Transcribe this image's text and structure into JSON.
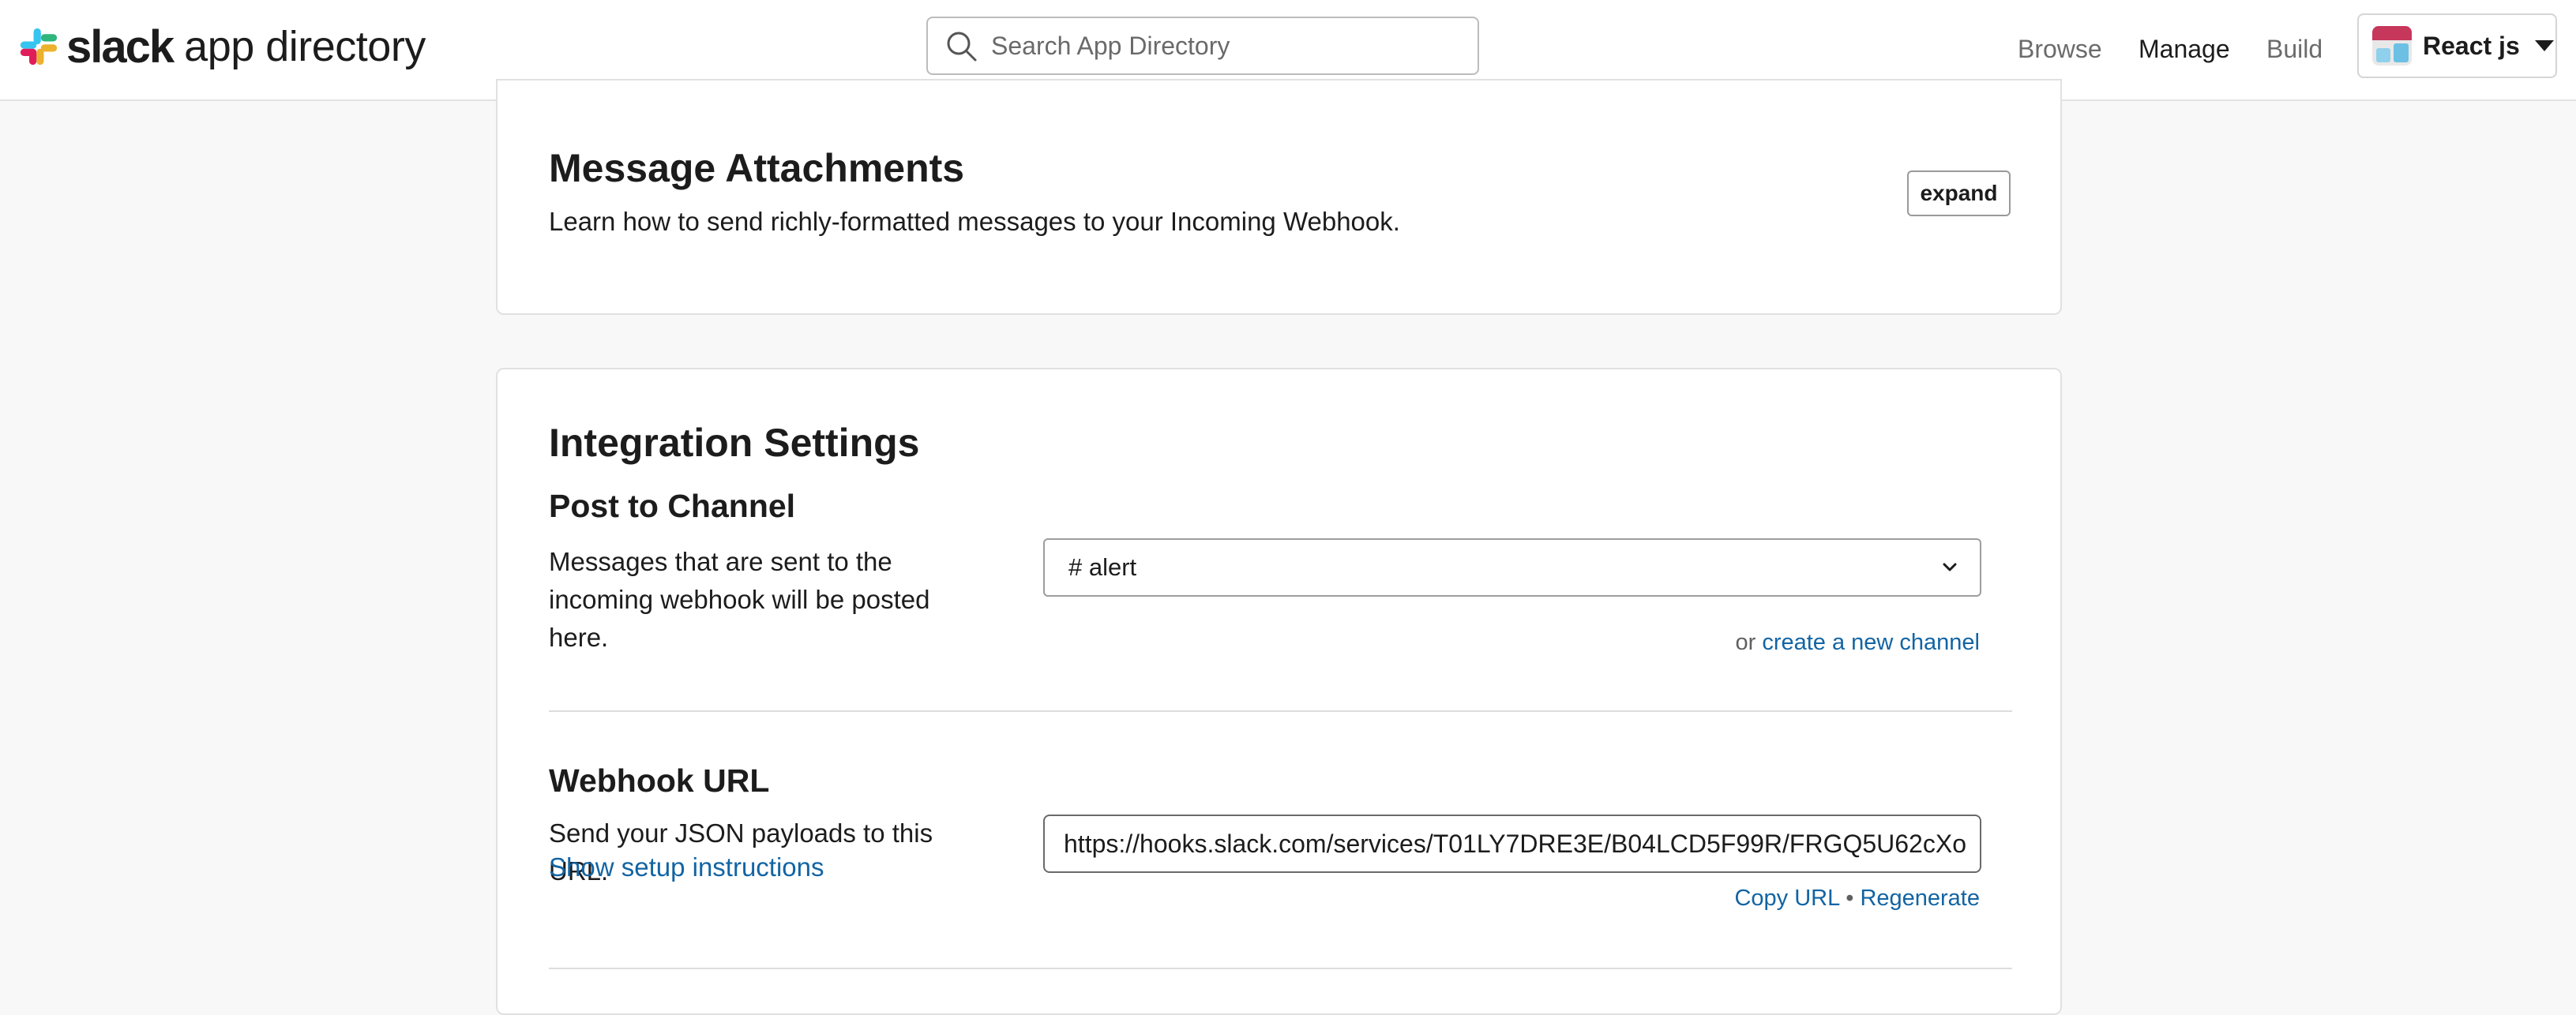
{
  "header": {
    "brand_bold": "slack",
    "brand_rest": "app directory",
    "search_placeholder": "Search App Directory",
    "nav": {
      "browse": "Browse",
      "manage": "Manage",
      "build": "Build"
    },
    "workspace_name": "React js"
  },
  "attachments_card": {
    "title": "Message Attachments",
    "description": "Learn how to send richly-formatted messages to your Incoming Webhook.",
    "expand_label": "expand"
  },
  "settings_card": {
    "title": "Integration Settings",
    "post_to_channel": {
      "title": "Post to Channel",
      "description": "Messages that are sent to the incoming webhook will be posted here.",
      "selected_channel": "# alert",
      "helper_prefix": "or",
      "create_channel_link": "create a new channel"
    },
    "webhook": {
      "title": "Webhook URL",
      "description": "Send your JSON payloads to this URL.",
      "setup_link": "Show setup instructions",
      "url": "https://hooks.slack.com/services/T01LY7DRE3E/B04LCD5F99R/FRGQ5U62cXo",
      "copy_link": "Copy URL",
      "separator": "•",
      "regenerate_link": "Regenerate"
    }
  },
  "colors": {
    "link": "#1264a3",
    "background": "#f8f8f8",
    "card": "#ffffff"
  }
}
